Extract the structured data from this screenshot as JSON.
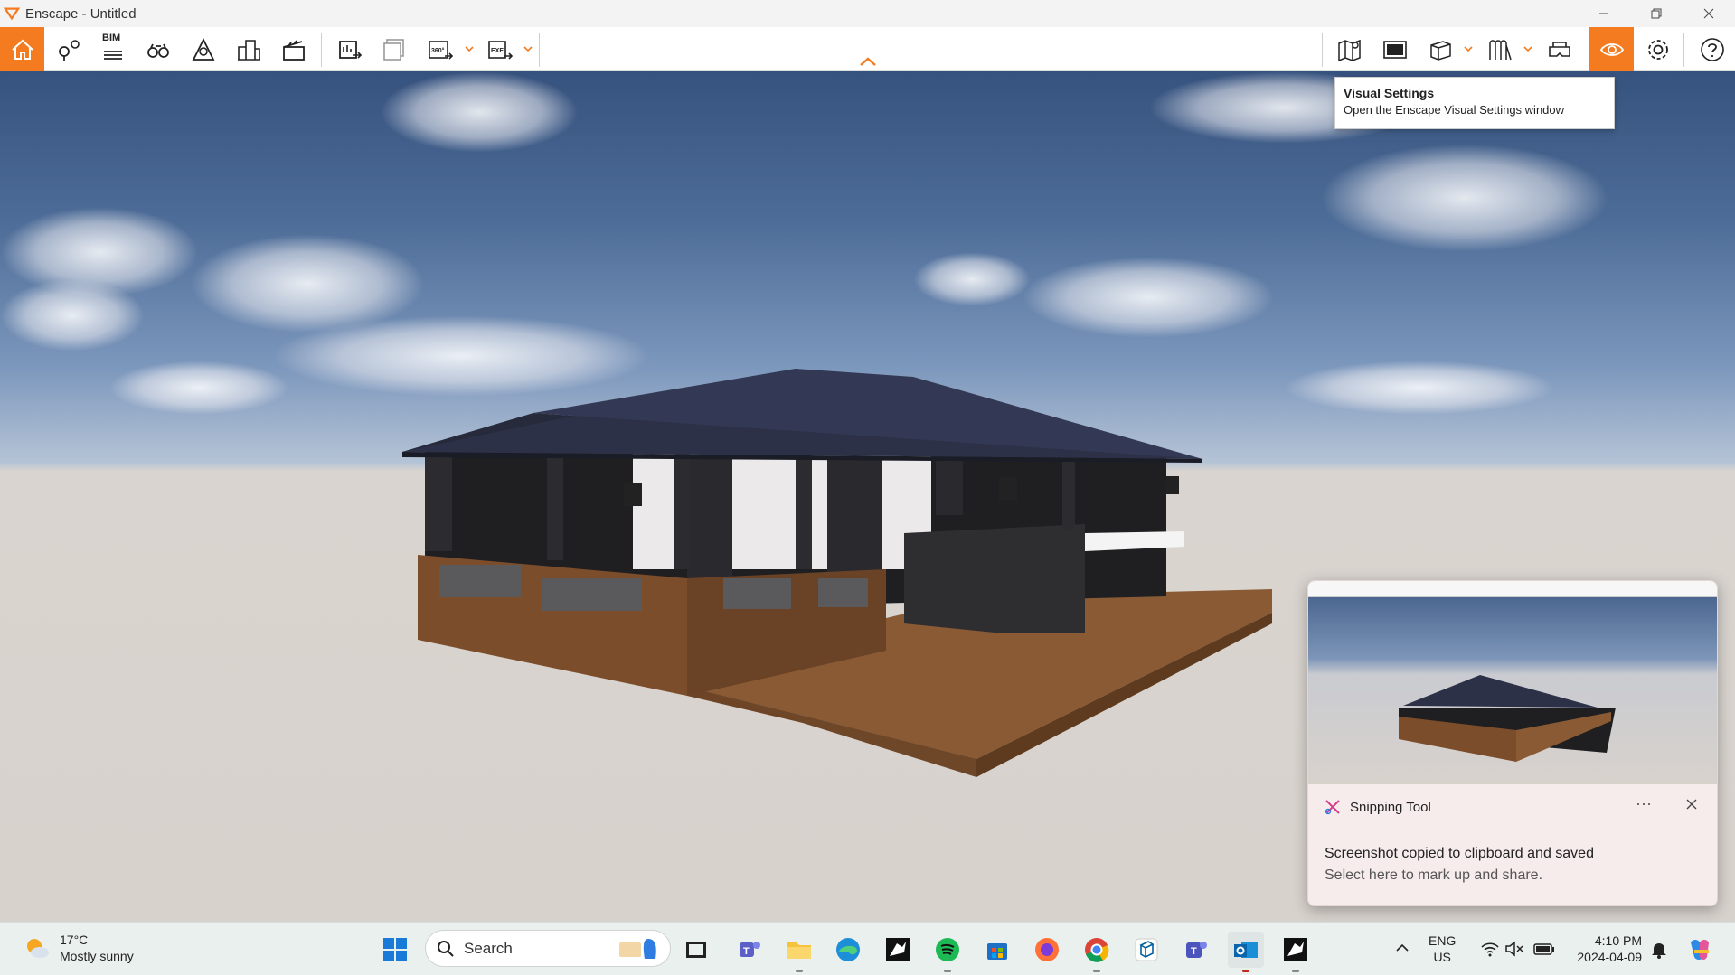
{
  "window": {
    "title": "Enscape - Untitled",
    "minimize_icon": "minimize-icon",
    "maximize_icon": "restore-icon",
    "close_icon": "close-icon"
  },
  "toolbar": {
    "accent_color": "#f47b20",
    "left_tools": [
      {
        "name": "home-icon",
        "active": true
      },
      {
        "name": "views-icon"
      },
      {
        "name": "bim-icon",
        "label": "BIM"
      },
      {
        "name": "binoculars-icon"
      },
      {
        "name": "atmosphere-icon"
      },
      {
        "name": "buildings-icon"
      },
      {
        "name": "clapper-icon"
      }
    ],
    "export_tools": [
      {
        "name": "render-export-icon"
      },
      {
        "name": "batch-render-icon"
      },
      {
        "name": "panorama-360-icon",
        "label": "360°"
      },
      {
        "name": "exe-export-icon",
        "label": "EXE"
      }
    ],
    "right_tools": [
      {
        "name": "map-icon"
      },
      {
        "name": "captures-icon"
      },
      {
        "name": "cube-icon"
      },
      {
        "name": "material-icon"
      },
      {
        "name": "vr-headset-icon"
      },
      {
        "name": "eye-icon",
        "active": true
      },
      {
        "name": "gear-icon"
      },
      {
        "name": "help-icon"
      }
    ]
  },
  "tooltip": {
    "title": "Visual Settings",
    "description": "Open the Enscape Visual Settings window"
  },
  "notification": {
    "app_name": "Snipping Tool",
    "more_label": "···",
    "message": "Screenshot copied to clipboard and saved",
    "subtext": "Select here to mark up and share."
  },
  "taskbar": {
    "weather": {
      "temperature": "17°C",
      "condition": "Mostly sunny"
    },
    "search_placeholder": "Search",
    "apps": [
      "windows-start-icon",
      "task-view-icon",
      "teams-icon",
      "file-explorer-icon",
      "edge-icon",
      "rhino-icon",
      "spotify-icon",
      "store-icon",
      "firefox-icon",
      "chrome-icon",
      "sketchup-icon",
      "teams-work-icon",
      "outlook-icon",
      "rhino-8-icon"
    ],
    "language": {
      "line1": "ENG",
      "line2": "US"
    },
    "clock": {
      "time": "4:10 PM",
      "date": "2024-04-09"
    }
  }
}
